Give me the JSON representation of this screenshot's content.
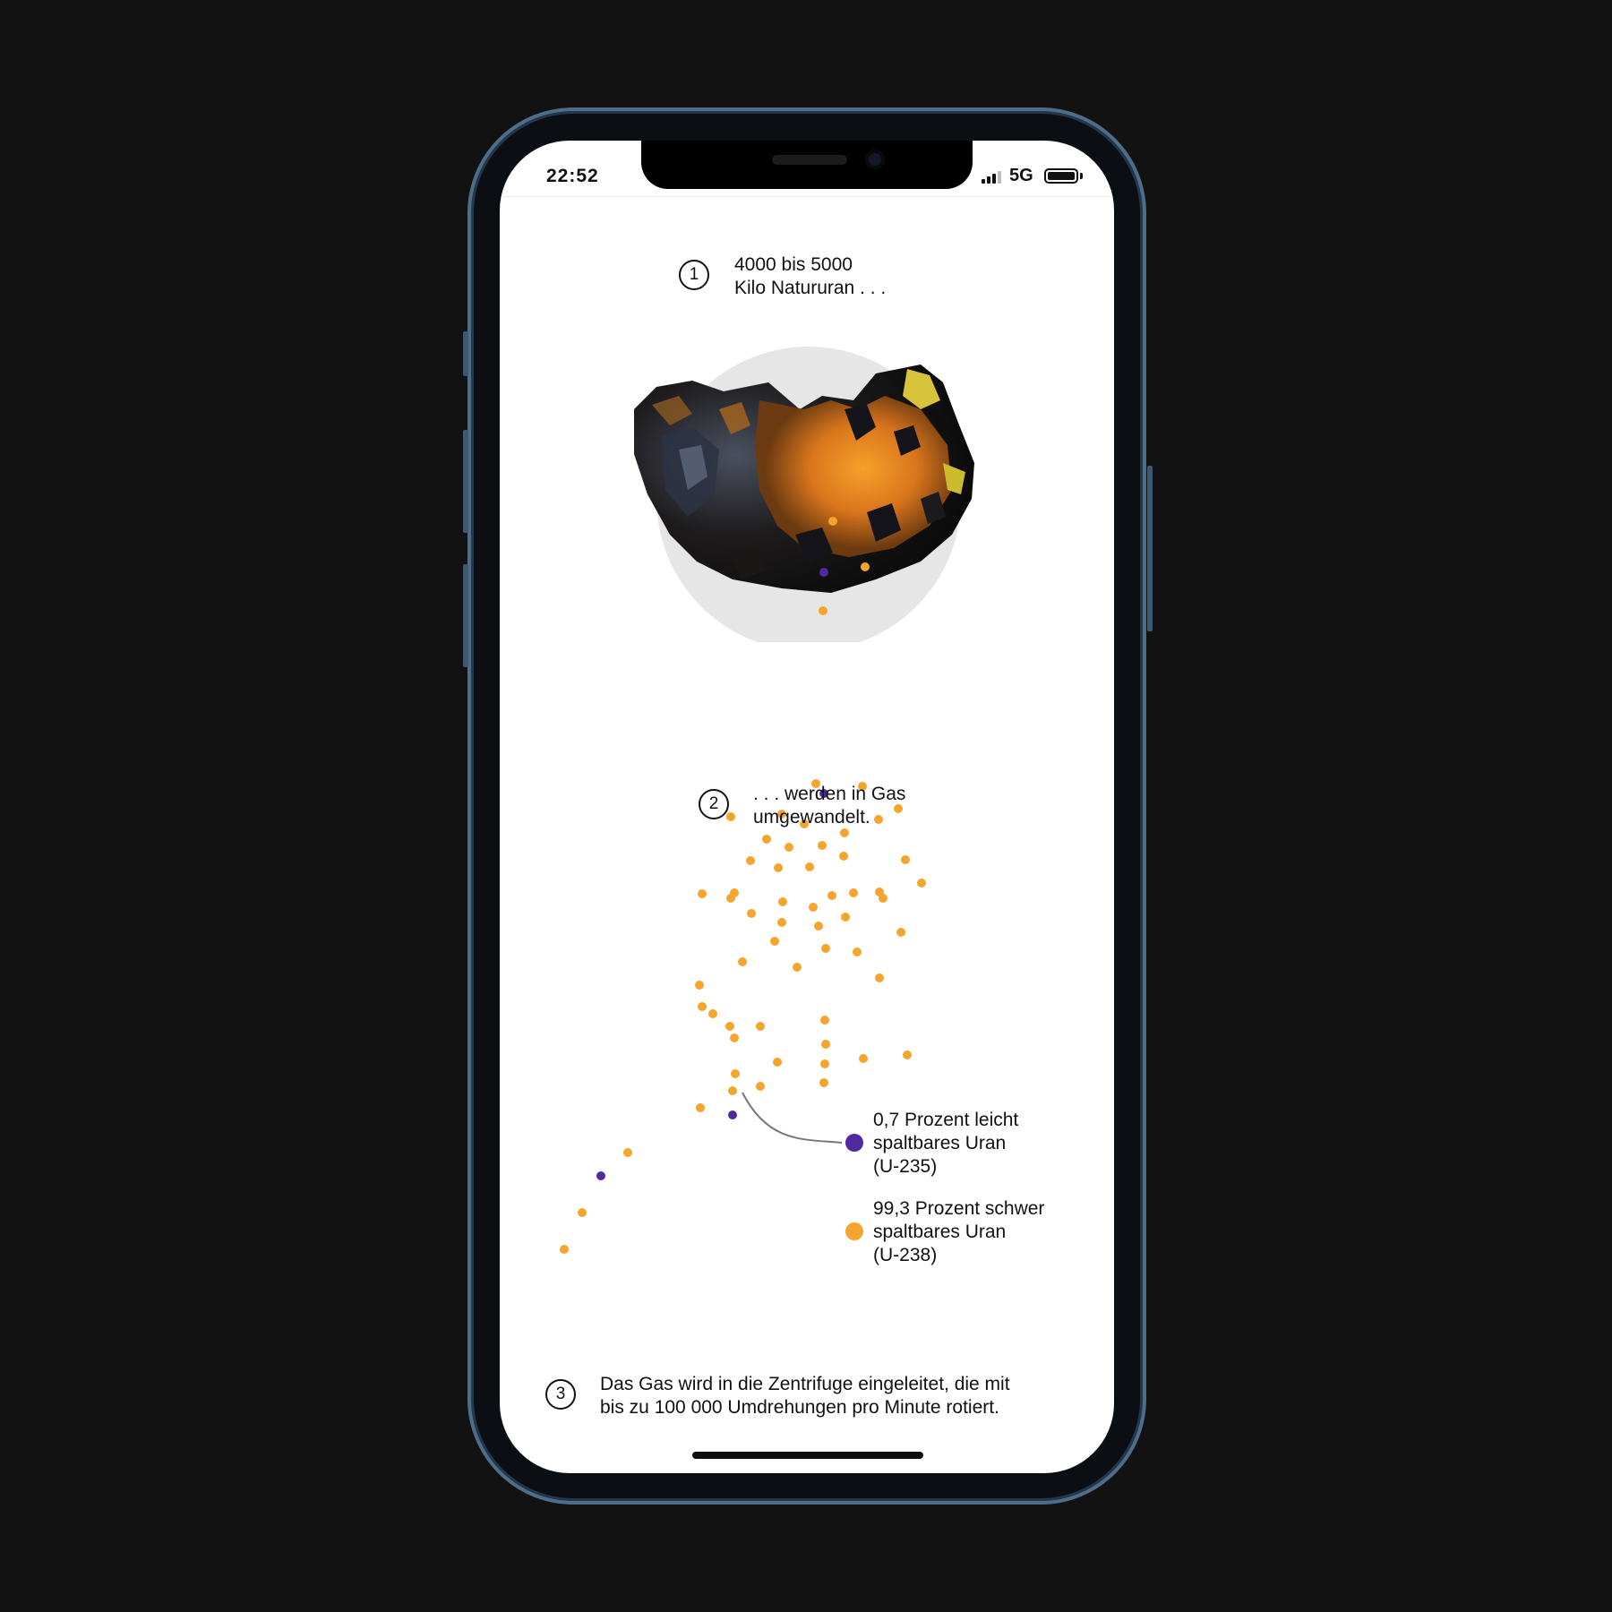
{
  "status_bar": {
    "time": "22:52",
    "network": "5G",
    "signal_icon": "cellular-signal-icon",
    "battery_icon": "battery-full-icon"
  },
  "colors": {
    "u238": "#f5a52d",
    "u235": "#4f2aa3",
    "text": "#111111",
    "page_bg": "#121212",
    "rock_halo": "#e6e6e6"
  },
  "steps": [
    {
      "number": "1",
      "lines": [
        "4000 bis 5000",
        "Kilo Natururan . . ."
      ]
    },
    {
      "number": "2",
      "lines": [
        ". . . werden in Gas",
        "umgewandelt."
      ]
    },
    {
      "number": "3",
      "lines": [
        "Das Gas wird in die Zentrifuge eingeleitet, die mit",
        "bis zu 100 000 Umdrehungen pro Minute rotiert."
      ]
    }
  ],
  "legend": [
    {
      "key": "u235",
      "lines": [
        "0,7 Prozent leicht",
        "spaltbares Uran",
        "(U-235)"
      ]
    },
    {
      "key": "u238",
      "lines": [
        "99,3 Prozent schwer",
        "spaltbares Uran",
        "(U-238)"
      ]
    }
  ],
  "image": {
    "name": "natural-uranium-ore-image"
  }
}
